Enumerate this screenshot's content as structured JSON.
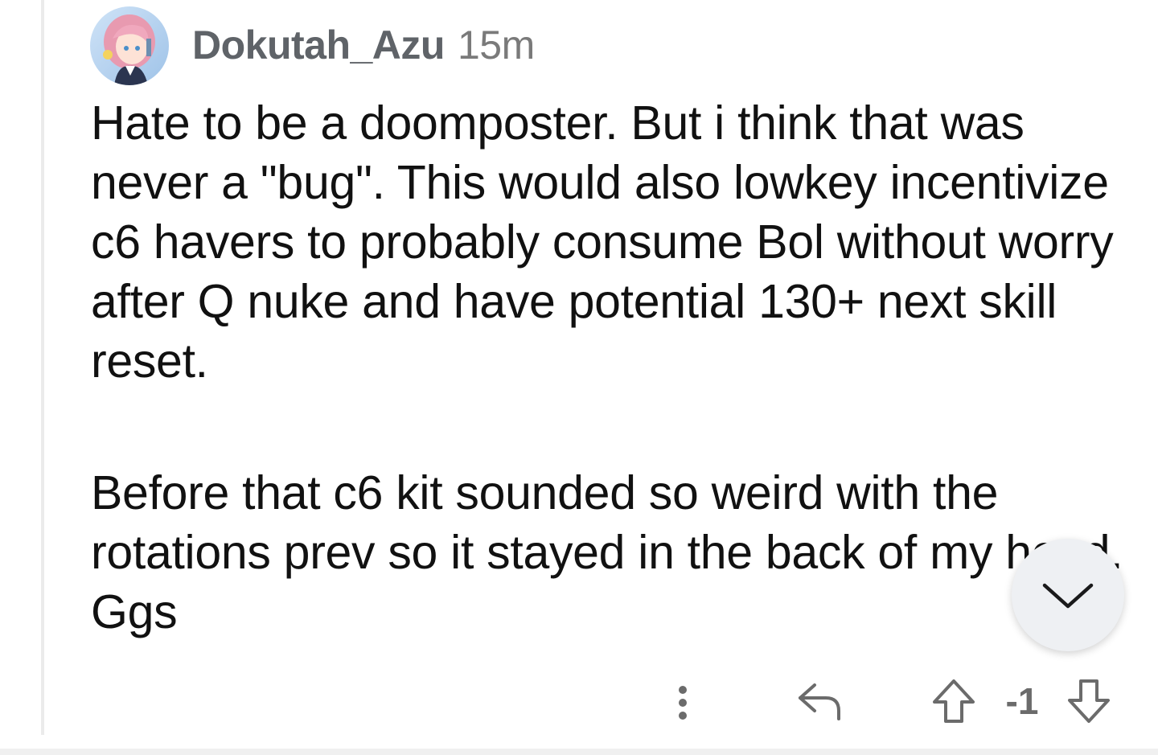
{
  "comment": {
    "author": "Dokutah_Azu",
    "time": "15m",
    "paragraphs": [
      "Hate to be a doomposter. But i think that was never a \"bug\". This would also lowkey incentivize c6 havers to probably consume Bol without worry after Q nuke and have potential 130+ next skill reset.",
      "Before that c6 kit sounded so weird with the rotations prev so it stayed in the back of my head. Ggs"
    ],
    "score": "-1"
  },
  "icons": {
    "avatar": "anime-avatar",
    "more": "more-vertical-icon",
    "reply": "reply-arrow-icon",
    "upvote": "upvote-arrow-icon",
    "downvote": "downvote-arrow-icon",
    "scroll": "chevron-down-icon"
  },
  "colors": {
    "author": "#5f6368",
    "timestamp": "#7a7a7a",
    "body_text": "#111111",
    "icons": "#6b6b6b",
    "fab_background": "#eef0f3"
  }
}
